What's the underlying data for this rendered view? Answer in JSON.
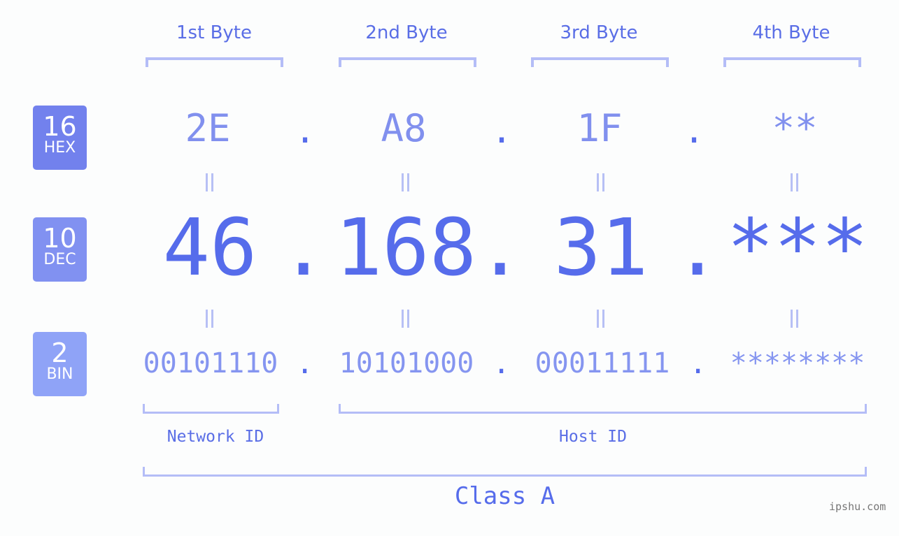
{
  "byte_headers": [
    "1st Byte",
    "2nd Byte",
    "3rd Byte",
    "4th Byte"
  ],
  "badges": {
    "hex": {
      "number": "16",
      "label": "HEX",
      "color": "#7281ed"
    },
    "dec": {
      "number": "10",
      "label": "DEC",
      "color": "#8191f1"
    },
    "bin": {
      "number": "2",
      "label": "BIN",
      "color": "#8fa3f7"
    }
  },
  "hex_values": [
    "2E",
    "A8",
    "1F",
    "**"
  ],
  "dec_values": [
    "46",
    "168",
    "31",
    "***"
  ],
  "bin_values": [
    "00101110",
    "10101000",
    "00011111",
    "********"
  ],
  "separator": ".",
  "parts": {
    "network": "Network ID",
    "host": "Host ID"
  },
  "ip_class": "Class A",
  "watermark": "ipshu.com",
  "colors": {
    "accent": "#566ceb",
    "bracket": "#b4bdf7",
    "background": "#fcfdfd"
  }
}
